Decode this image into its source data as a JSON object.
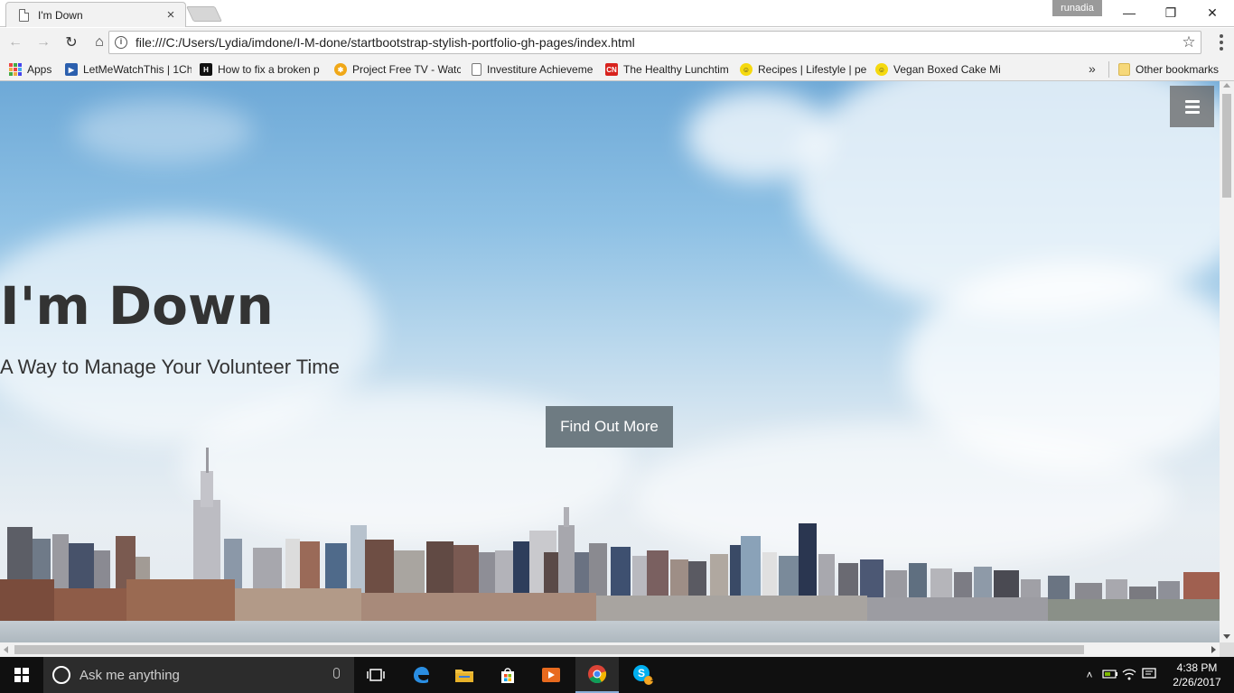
{
  "browser": {
    "tab_title": "I'm Down",
    "tab_close": "×",
    "profile_name": "runadia",
    "url": "file:///C:/Users/Lydia/imdone/I-M-done/startbootstrap-stylish-portfolio-gh-pages/index.html",
    "window_controls": {
      "minimize": "—",
      "restore": "❐",
      "close": "✕"
    },
    "nav": {
      "back": "←",
      "forward": "→",
      "reload": "↻",
      "home": "⌂",
      "star": "☆"
    }
  },
  "bookmarks": {
    "items": [
      {
        "label": "Apps",
        "icon": "apps-grid-icon"
      },
      {
        "label": "LetMeWatchThis | 1Ch",
        "icon": "clapperboard-icon",
        "color": "#2b5fae"
      },
      {
        "label": "How to fix a broken p",
        "icon": "h-icon",
        "color": "#111111"
      },
      {
        "label": "Project Free TV - Watc",
        "icon": "sun-icon",
        "color": "#f0a818"
      },
      {
        "label": "Investiture Achieveme",
        "icon": "page-icon",
        "color": "#ffffff"
      },
      {
        "label": "The Healthy Lunchtim",
        "icon": "cn-icon",
        "color": "#d8231e"
      },
      {
        "label": "Recipes | Lifestyle | pe",
        "icon": "smiley-icon",
        "color": "#f5d90f"
      },
      {
        "label": "Vegan Boxed Cake Mi",
        "icon": "smiley-icon",
        "color": "#f5d90f"
      }
    ],
    "overflow": "»",
    "other": "Other bookmarks"
  },
  "page": {
    "hero_title": "I'm Down",
    "hero_subtitle": "A Way to Manage Your Volunteer Time",
    "hero_button": "Find Out More"
  },
  "taskbar": {
    "search_placeholder": "Ask me anything",
    "time": "4:38 PM",
    "date": "2/26/2017",
    "skype_badge": "1"
  }
}
